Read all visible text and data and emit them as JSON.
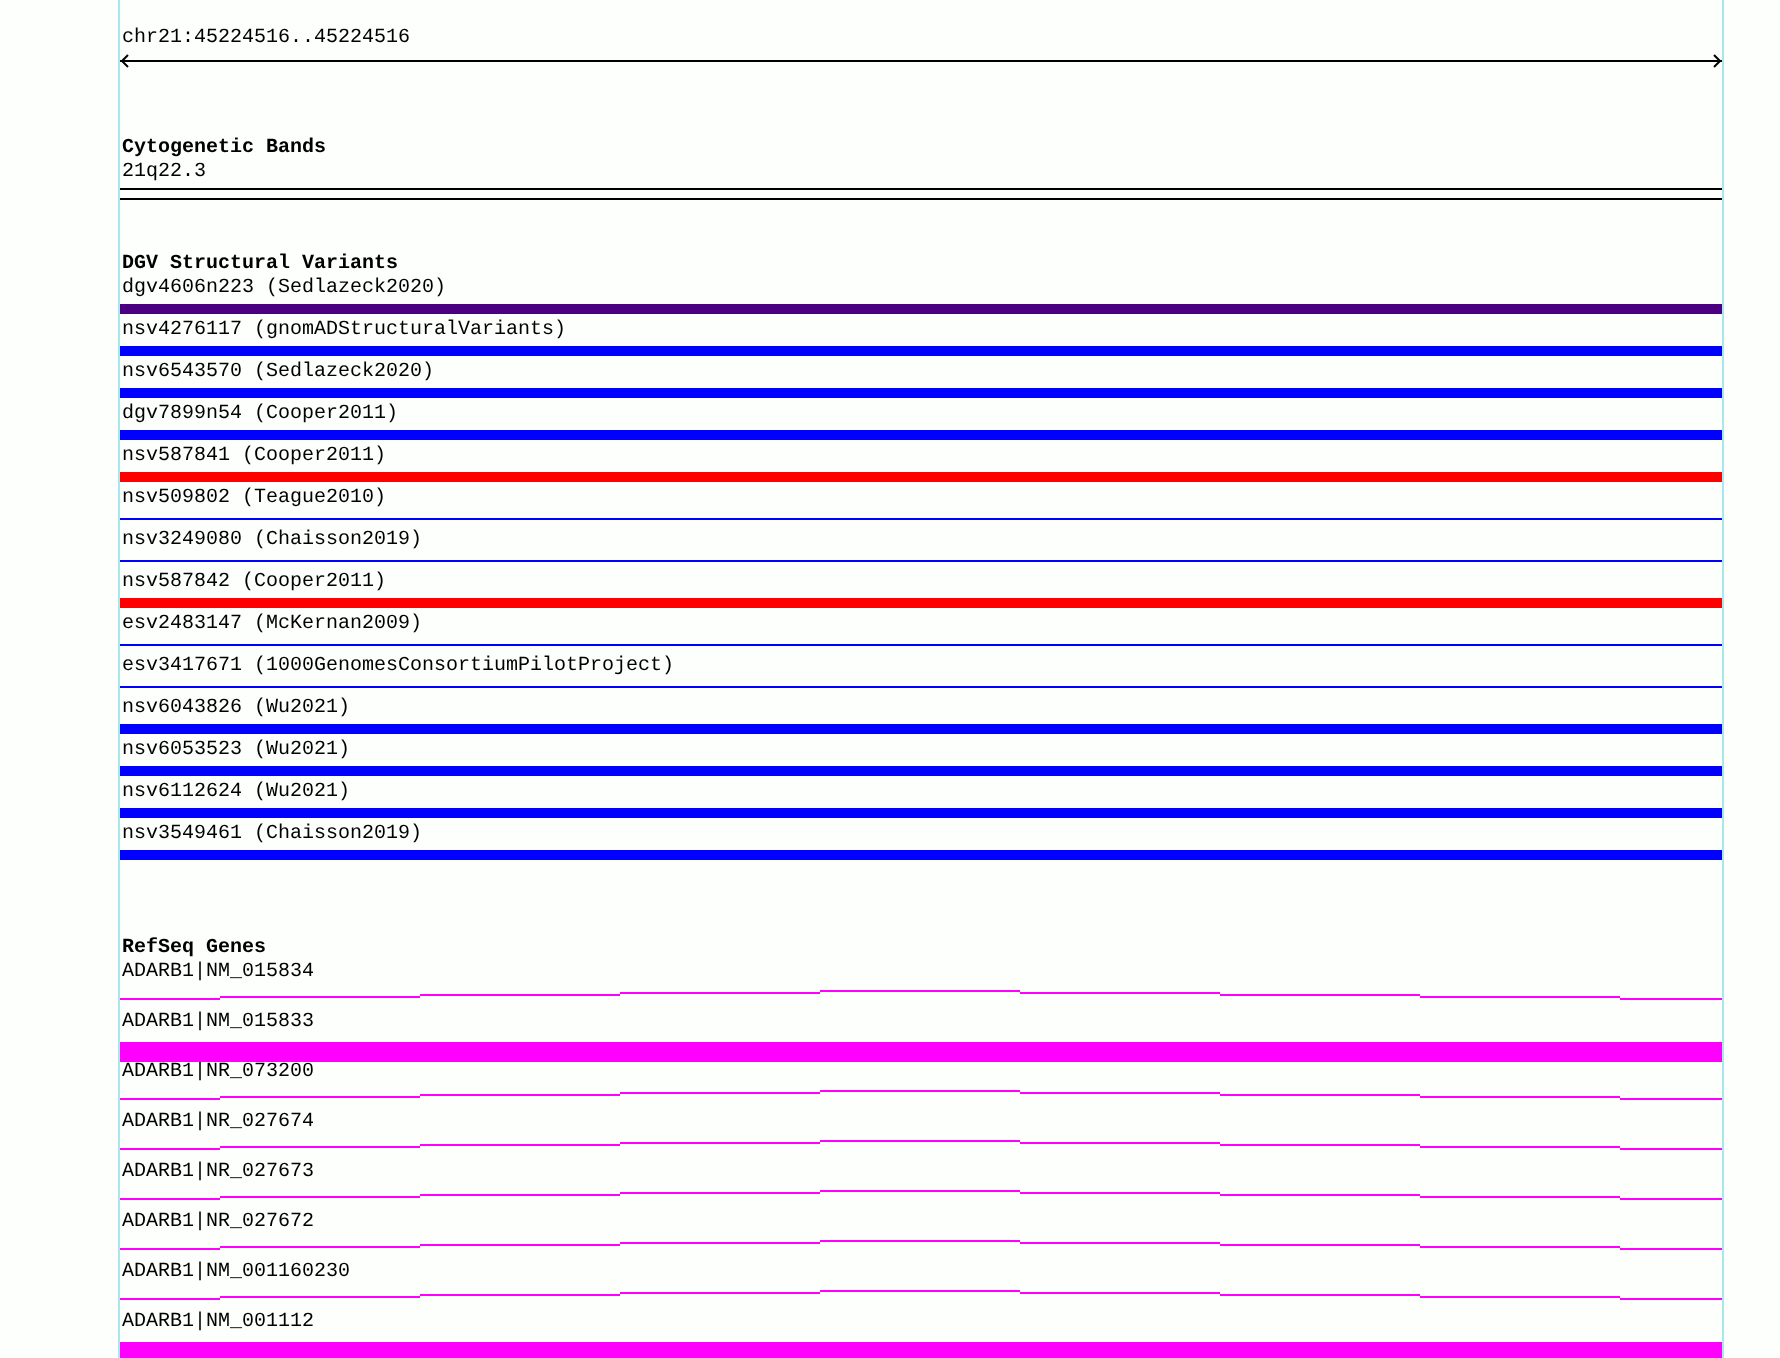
{
  "locus": {
    "coordinates": "chr21:45224516..45224516"
  },
  "tracks": [
    {
      "title": "Cytogenetic Bands",
      "features": [
        {
          "label": "21q22.3",
          "kind": "band",
          "color": "#000000"
        }
      ]
    },
    {
      "title": "DGV Structural Variants",
      "features": [
        {
          "label": "dgv4606n223 (Sedlazeck2020)",
          "kind": "thick",
          "color": "#4b0082"
        },
        {
          "label": "nsv4276117 (gnomADStructuralVariants)",
          "kind": "thick",
          "color": "#0000ff"
        },
        {
          "label": "nsv6543570 (Sedlazeck2020)",
          "kind": "thick",
          "color": "#0000ff"
        },
        {
          "label": "dgv7899n54 (Cooper2011)",
          "kind": "thick",
          "color": "#0000ff"
        },
        {
          "label": "nsv587841 (Cooper2011)",
          "kind": "thick",
          "color": "#ff0000"
        },
        {
          "label": "nsv509802 (Teague2010)",
          "kind": "thin",
          "color": "#0000ff"
        },
        {
          "label": "nsv3249080 (Chaisson2019)",
          "kind": "thin",
          "color": "#0000ff"
        },
        {
          "label": "nsv587842 (Cooper2011)",
          "kind": "thick",
          "color": "#ff0000"
        },
        {
          "label": "esv2483147 (McKernan2009)",
          "kind": "thin",
          "color": "#0000ff"
        },
        {
          "label": "esv3417671 (1000GenomesConsortiumPilotProject)",
          "kind": "thin",
          "color": "#0000ff"
        },
        {
          "label": "nsv6043826 (Wu2021)",
          "kind": "thick",
          "color": "#0000ff"
        },
        {
          "label": "nsv6053523 (Wu2021)",
          "kind": "thick",
          "color": "#0000ff"
        },
        {
          "label": "nsv6112624 (Wu2021)",
          "kind": "thick",
          "color": "#0000ff"
        },
        {
          "label": "nsv3549461 (Chaisson2019)",
          "kind": "thick",
          "color": "#0000ff"
        }
      ]
    },
    {
      "title": "RefSeq Genes",
      "features": [
        {
          "label": "ADARB1|NM_015834",
          "kind": "intron",
          "color": "#ff00ff"
        },
        {
          "label": "ADARB1|NM_015833",
          "kind": "exon",
          "color": "#ff00ff"
        },
        {
          "label": "ADARB1|NR_073200",
          "kind": "intron",
          "color": "#ff00ff"
        },
        {
          "label": "ADARB1|NR_027674",
          "kind": "intron",
          "color": "#ff00ff"
        },
        {
          "label": "ADARB1|NR_027673",
          "kind": "intron",
          "color": "#ff00ff"
        },
        {
          "label": "ADARB1|NR_027672",
          "kind": "intron",
          "color": "#ff00ff"
        },
        {
          "label": "ADARB1|NM_001160230",
          "kind": "intron",
          "color": "#ff00ff"
        },
        {
          "label": "ADARB1|NM_001112",
          "kind": "exon",
          "color": "#ff00ff"
        }
      ]
    }
  ]
}
